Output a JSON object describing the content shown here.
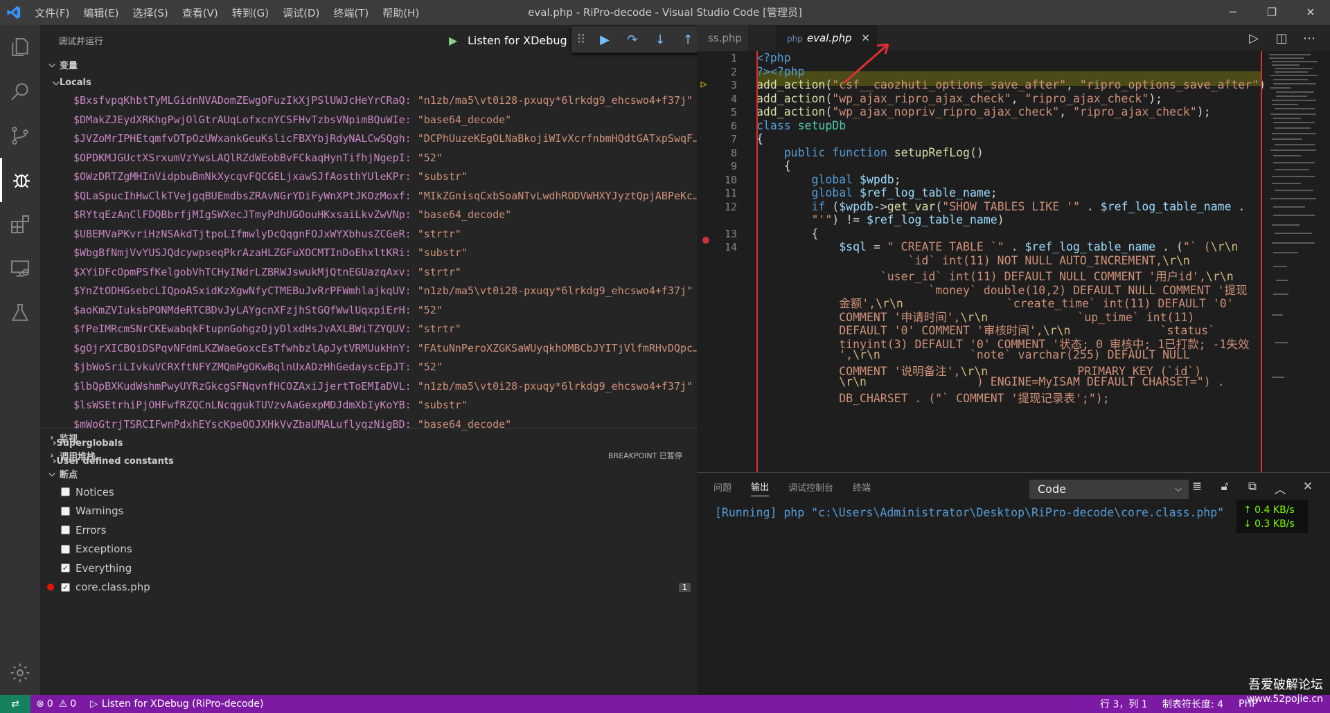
{
  "titlebar": {
    "menu": [
      "文件(F)",
      "编辑(E)",
      "选择(S)",
      "查看(V)",
      "转到(G)",
      "调试(D)",
      "终端(T)",
      "帮助(H)"
    ],
    "title": "eval.php - RiPro-decode - Visual Studio Code [管理员]"
  },
  "sidebar": {
    "title": "调试并运行",
    "launch_config": "Listen for XDebug",
    "variables_section": "变量",
    "locals": "Locals",
    "vars": [
      {
        "k": "$BxsfvpqKhbtTyMLGidnNVADomZEwgOFuzIkXjPSlUWJcHeYrCRaQ:",
        "v": "\"n1zb/ma5\\vt0i28-pxuqy*6lrkdg9_ehcswo4+f37j\""
      },
      {
        "k": "$DMakZJEydXRKhgPwjOlGtrAUqLofxcnYCSFHvTzbsVNpimBQuWIe:",
        "v": "\"base64_decode\""
      },
      {
        "k": "$JVZoMrIPHEtqmfvDTpOzUWxankGeuKslicFBXYbjRdyNALCwSQgh:",
        "v": "\"DCPhUuzeKEgOLNaBkojiWIvXcrfnbmHQdtGATxpSwqF…"
      },
      {
        "k": "$OPDKMJGUctXSrxumVzYwsLAQlRZdWEobBvFCkaqHynTifhjNgepI:",
        "v": "\"52\""
      },
      {
        "k": "$OWzDRTZgMHInVidpbuBmNkXycqvFQCGELjxawSJfAosthYUleKPr:",
        "v": "\"substr\""
      },
      {
        "k": "$QLaSpucIhHwClkTVejgqBUEmdbsZRAvNGrYDiFyWnXPtJKOzMoxf:",
        "v": "\"MIkZGnisqCxbSoaNTvLwdhRODVWHXYJyztQpjABPeKc…"
      },
      {
        "k": "$RYtqEzAnClFDQBbrfjMIgSWXecJTmyPdhUGOouHKxsaiLkvZwVNp:",
        "v": "\"base64_decode\""
      },
      {
        "k": "$UBEMVaPKvriHzNSAkdTjtpoLIfmwlyDcQqgnFOJxWYXbhusZCGeR:",
        "v": "\"strtr\""
      },
      {
        "k": "$WbgBfNmjVvYUSJQdcywpseqPkrAzaHLZGFuXOCMTInDoEhxltKRi:",
        "v": "\"substr\""
      },
      {
        "k": "$XYiDFcOpmPSfKelgobVhTCHyINdrLZBRWJswukMjQtnEGUazqAxv:",
        "v": "\"strtr\""
      },
      {
        "k": "$YnZtODHGsebcLIQpoASxidKzXgwNfyCTMEBuJvRrPFWmhlajkqUV:",
        "v": "\"n1zb/ma5\\vt0i28-pxuqy*6lrkdg9_ehcswo4+f37j\""
      },
      {
        "k": "$aoKmZVIuksbPONMdeRTCBDvJyLAYgcnXFzjhStGQfWwlUqxpiErH:",
        "v": "\"52\""
      },
      {
        "k": "$fPeIMRcmSNrCKEwabqkFtupnGohgzOjyDlxdHsJvAXLBWiTZYQUV:",
        "v": "\"strtr\""
      },
      {
        "k": "$gOjrXICBQiDSPqvNFdmLKZWaeGoxcEsTfwhbzlApJytVRMUukHnY:",
        "v": "\"FAtuNnPeroXZGKSaWUyqkhOMBCbJYITjVlfmRHvDQpc…"
      },
      {
        "k": "$jbWoSriLIvkuVCRXftNFYZMQmPgOKwBqlnUxADzHhGedayscEpJT:",
        "v": "\"52\""
      },
      {
        "k": "$lbQpBXKudWshmPwyUYRzGkcgSFNqvnfHCOZAxiJjertToEMIaDVL:",
        "v": "\"n1zb/ma5\\vt0i28-pxuqy*6lrkdg9_ehcswo4+f37j\""
      },
      {
        "k": "$lsWSEtrhiPjOHFwfRZQCnLNcqgukTUVzvAaGexpMDJdmXbIyKoYB:",
        "v": "\"substr\""
      },
      {
        "k": "$mWoGtrjTSRCIFwnPdxhEYscKpeQOJXHkVvZbaUMALuflyqzNigBD:",
        "v": "\"base64_decode\""
      }
    ],
    "superglobals": "Superglobals",
    "user_constants": "User defined constants",
    "watch": "监视",
    "callstack": "调用堆栈",
    "callstack_status": "BREAKPOINT 已暂停",
    "breakpoints": "断点",
    "bps": [
      {
        "label": "Notices",
        "checked": false
      },
      {
        "label": "Warnings",
        "checked": false
      },
      {
        "label": "Errors",
        "checked": false
      },
      {
        "label": "Exceptions",
        "checked": false
      },
      {
        "label": "Everything",
        "checked": true
      },
      {
        "label": "core.class.php",
        "checked": true
      }
    ],
    "bp_count": "1"
  },
  "tabs": [
    {
      "label": "ss.php"
    },
    {
      "label": "eval.php"
    }
  ],
  "editor": {
    "line_numbers": [
      "1",
      "2",
      "3",
      "4",
      "5",
      "6",
      "7",
      "8",
      "9",
      "10",
      "11",
      "12",
      "",
      "13",
      "14"
    ]
  },
  "panel": {
    "tabs": [
      "问题",
      "输出",
      "调试控制台",
      "终端"
    ],
    "channel": "Code",
    "output": "[Running] php \"c:\\Users\\Administrator\\Desktop\\RiPro-decode\\core.class.php\""
  },
  "netspeed": {
    "up": "↑ 0.4 KB/s",
    "down": "↓ 0.3 KB/s"
  },
  "status": {
    "errors": "0",
    "warnings": "0",
    "debug": "Listen for XDebug (RiPro-decode)",
    "position": "行 3，列 1",
    "tabsize": "制表符长度: 4",
    "lang": "PHP"
  },
  "watermark": {
    "line1": "吾爱破解论坛",
    "line2": "www.52pojie.cn"
  },
  "colors": {
    "statusbar": "#7c1aa3",
    "highlight_box": "#e03030",
    "accent": "#3794ff"
  }
}
